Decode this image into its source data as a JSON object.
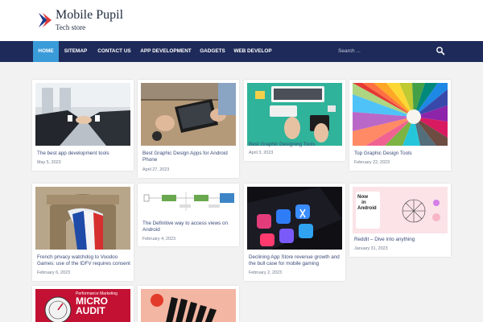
{
  "site": {
    "title": "Mobile Pupil",
    "tagline": "Tech store"
  },
  "nav": {
    "items": [
      {
        "label": "HOME"
      },
      {
        "label": "SITEMAP"
      },
      {
        "label": "CONTACT US"
      },
      {
        "label": "APP DEVELOPMENT"
      },
      {
        "label": "GADGETS"
      },
      {
        "label": "WEB DEVELOP"
      }
    ],
    "active_item": "HOME",
    "search_placeholder": "Search ...",
    "search_icon": "magnifier-icon"
  },
  "posts": [
    {
      "title": "The best app development tools",
      "date": "May 5, 2023",
      "image": "handshake-office"
    },
    {
      "title": "Best Graphic Design Apps for Android Phone",
      "date": "April 27, 2023",
      "image": "drawing-tablet"
    },
    {
      "title": "Best Graphic Designing Tools",
      "date": "April 3, 2023",
      "image": "designer-desk-teal"
    },
    {
      "title": "Top Graphic Design Tools",
      "date": "February 22, 2023",
      "image": "colored-pencils"
    },
    {
      "title": "French privacy watchdog to Voodoo Games: use of the IDFV requires consent",
      "date": "February 6, 2023",
      "image": "arc-de-triomphe-flag"
    },
    {
      "title": "The Definitive way to access views on Android",
      "date": "February 4, 2023",
      "image": "flow-diagram"
    },
    {
      "title": "Declining App Store revenue growth and the bull case for mobile gaming",
      "date": "February 2, 2023",
      "image": "phone-app-store"
    },
    {
      "title": "Reddit – Dive into anything",
      "date": "January 31, 2023",
      "image": "now-in-android"
    },
    {
      "title": "",
      "date": "",
      "image": "micro-audit",
      "image_text": "Performance Marketing MICRO AUDIT"
    },
    {
      "title": "",
      "date": "",
      "image": "dominoes-peach"
    }
  ],
  "colors": {
    "navbar": "#1e2a59",
    "active_tab": "#3a9bd9",
    "background": "#f2f2f2",
    "title_link": "#3a4a7a"
  }
}
